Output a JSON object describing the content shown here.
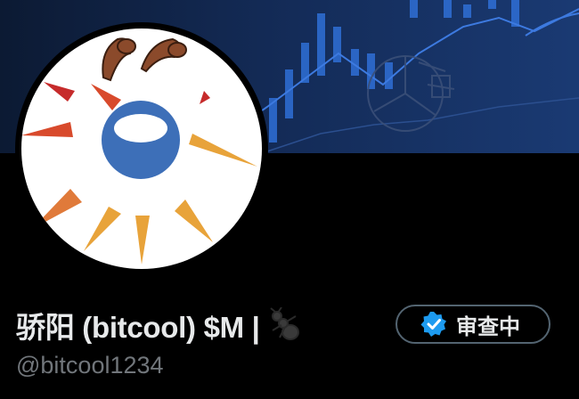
{
  "profile": {
    "display_name": "骄阳 (bitcool) $M |",
    "name_emoji_icon": "ant-icon",
    "handle": "@bitcool1234",
    "badge_label": "审查中",
    "verified_icon": "blue-check-icon"
  },
  "colors": {
    "background": "#000000",
    "name_text": "#e7e9ea",
    "handle_text": "#71767b",
    "verified_blue": "#1d9bf0",
    "banner_dark": "#0c1a33",
    "banner_light": "#1a3a73"
  },
  "avatar": {
    "description_icon": "sun-logo-icon"
  }
}
